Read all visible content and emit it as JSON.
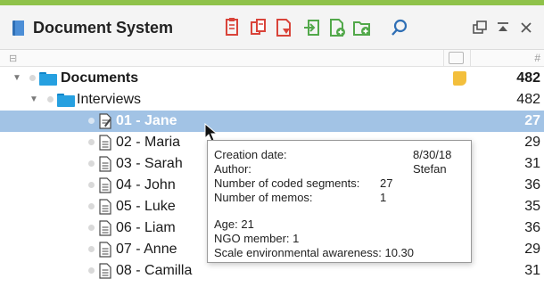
{
  "window": {
    "title": "Document System",
    "accent_color": "#8fc24a",
    "toolbar": [
      {
        "icon": "activate-documents-icon"
      },
      {
        "icon": "activate-sets-icon"
      },
      {
        "icon": "filter-document-icon"
      },
      {
        "icon": "import-document-icon"
      },
      {
        "icon": "new-document-icon"
      },
      {
        "icon": "new-document-group-icon"
      },
      {
        "icon": "search-icon"
      },
      {
        "icon": "undock-window-icon"
      },
      {
        "icon": "minimize-window-icon"
      },
      {
        "icon": "close-window-icon"
      }
    ]
  },
  "columns": {
    "tree_glyph": "⊟",
    "count_header": "#"
  },
  "tree": {
    "root": {
      "label": "Documents",
      "count": "482",
      "memo_color": "#f3bf3c"
    },
    "group": {
      "label": "Interviews",
      "count": "482"
    },
    "documents": [
      {
        "label": "01 - Jane",
        "count": "27",
        "selected": true
      },
      {
        "label": "02 - Maria",
        "count": "29"
      },
      {
        "label": "03 - Sarah",
        "count": "31"
      },
      {
        "label": "04 - John",
        "count": "36"
      },
      {
        "label": "05 - Luke",
        "count": "35"
      },
      {
        "label": "06 - Liam",
        "count": "36"
      },
      {
        "label": "07 - Anne",
        "count": "29"
      },
      {
        "label": "08 - Camilla",
        "count": "31"
      }
    ]
  },
  "tooltip": {
    "creation_date_label": "Creation date:",
    "creation_date_value": "8/30/18",
    "author_label": "Author:",
    "author_value": "Stefan",
    "coded_segments_label": "Number of coded segments:",
    "coded_segments_value": "27",
    "memos_label": "Number of memos:",
    "memos_value": "1",
    "age": "Age: 21",
    "ngo": "NGO member: 1",
    "scale": "Scale environmental awareness: 10.30"
  },
  "colors": {
    "selection": "#a2c3e5",
    "folder": "#26a0e0",
    "toolbar_red": "#d9443a",
    "toolbar_green": "#52a84a",
    "toolbar_blue": "#2f6fb5"
  }
}
